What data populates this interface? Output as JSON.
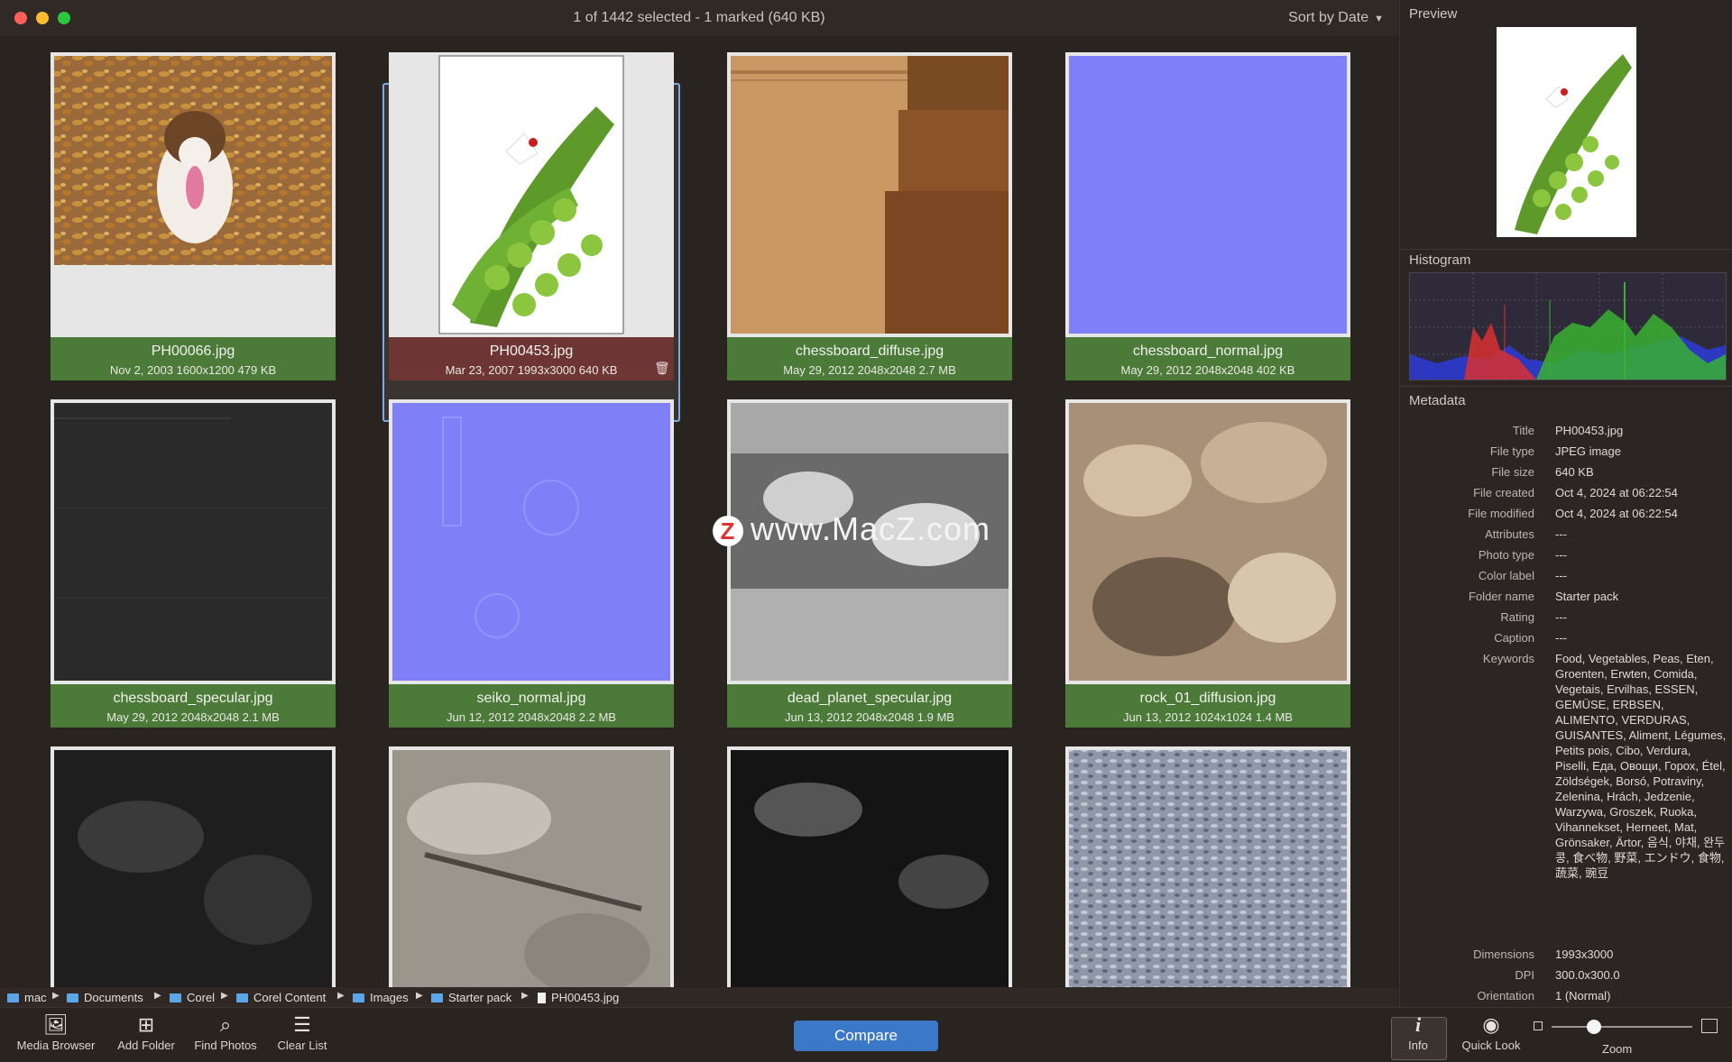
{
  "titlebar": {
    "status": "1 of 1442 selected - 1 marked (640 KB)",
    "sort_label": "Sort by Date"
  },
  "tiles": [
    {
      "name": "PH00066.jpg",
      "info": "Nov 2, 2003  1600x1200  479 KB"
    },
    {
      "name": "PH00453.jpg",
      "info": "Mar 23, 2007  1993x3000  640 KB",
      "selected": true
    },
    {
      "name": "chessboard_diffuse.jpg",
      "info": "May 29, 2012  2048x2048  2.7 MB"
    },
    {
      "name": "chessboard_normal.jpg",
      "info": "May 29, 2012  2048x2048  402 KB"
    },
    {
      "name": "chessboard_specular.jpg",
      "info": "May 29, 2012  2048x2048  2.1 MB"
    },
    {
      "name": "seiko_normal.jpg",
      "info": "Jun 12, 2012  2048x2048  2.2 MB"
    },
    {
      "name": "dead_planet_specular.jpg",
      "info": "Jun 13, 2012  2048x2048  1.9 MB"
    },
    {
      "name": "rock_01_diffusion.jpg",
      "info": "Jun 13, 2012  1024x1024  1.4 MB"
    }
  ],
  "watermark": {
    "logo": "Z",
    "text": "www.MacZ.com"
  },
  "path": [
    "mac",
    "Documents",
    "Corel",
    "Corel Content",
    "Images",
    "Starter pack",
    "PH00453.jpg"
  ],
  "toolbar": {
    "media_browser": "Media Browser",
    "add_folder": "Add Folder",
    "find_photos": "Find Photos",
    "clear_list": "Clear List",
    "compare": "Compare",
    "info": "Info",
    "quick_look": "Quick Look",
    "zoom": "Zoom",
    "zoom_level": 0.3
  },
  "panel": {
    "preview_title": "Preview",
    "histogram_title": "Histogram",
    "metadata_title": "Metadata",
    "metadata": [
      {
        "key": "Title",
        "value": "PH00453.jpg"
      },
      {
        "key": "File type",
        "value": "JPEG image"
      },
      {
        "key": "File size",
        "value": "640 KB"
      },
      {
        "key": "File created",
        "value": "Oct 4, 2024 at 06:22:54"
      },
      {
        "key": "File modified",
        "value": "Oct 4, 2024 at 06:22:54"
      },
      {
        "key": "Attributes",
        "value": "---"
      },
      {
        "key": "Photo type",
        "value": "---"
      },
      {
        "key": "Color label",
        "value": "---"
      },
      {
        "key": "Folder name",
        "value": "Starter pack"
      },
      {
        "key": "Rating",
        "value": "---"
      },
      {
        "key": "Caption",
        "value": "---"
      },
      {
        "key": "Keywords",
        "value": "Food, Vegetables, Peas, Eten, Groenten, Erwten, Comida, Vegetais, Ervilhas, ESSEN, GEMÜSE, ERBSEN, ALIMENTO, VERDURAS, GUISANTES, Aliment, Légumes, Petits pois, Cibo, Verdura, Piselli, Еда, Овощи, Горох, Étel, Zöldségek, Borsó, Potraviny, Zelenina, Hrách, Jedzenie, Warzywa, Groszek, Ruoka, Vihannekset, Herneet, Mat, Grönsaker, Ärtor, 음식, 야채, 완두콩, 食べ物, 野菜, エンドウ, 食物, 蔬菜, 豌豆"
      },
      {
        "key": "Dimensions",
        "value": "1993x3000"
      },
      {
        "key": "DPI",
        "value": "300.0x300.0"
      },
      {
        "key": "Orientation",
        "value": "1 (Normal)"
      }
    ]
  },
  "colors": {
    "caption_green": "#4c7a38",
    "caption_selected": "#6e3535",
    "selection_border": "#7fa9e6",
    "compare_button": "#3c78c8"
  }
}
